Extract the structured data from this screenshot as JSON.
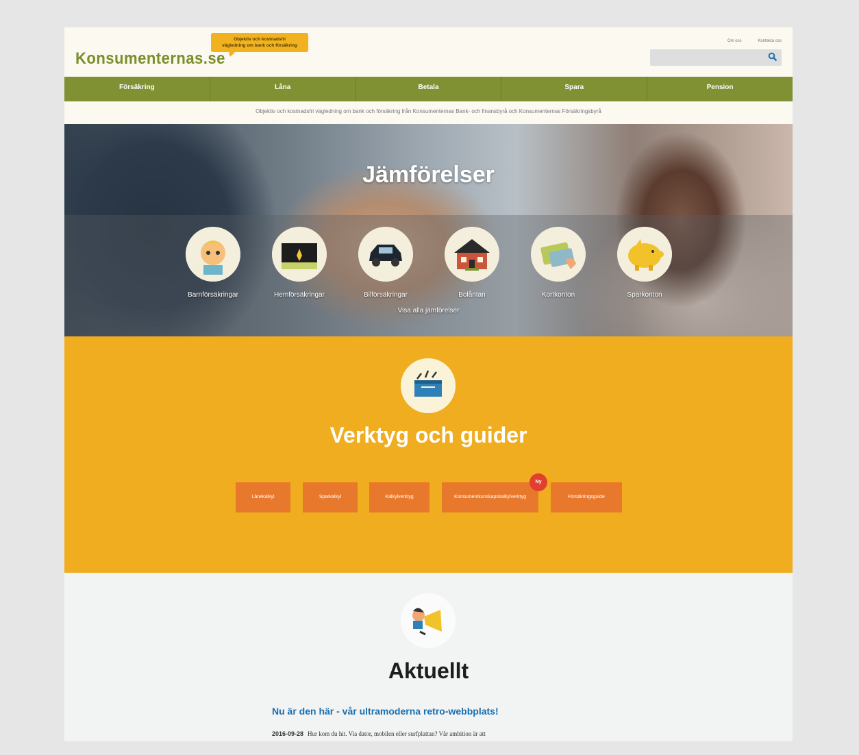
{
  "header": {
    "logo": "Konsumenternas.se",
    "bubble_line1": "Objektiv och kostnadsfri",
    "bubble_line2": "vägledning om bank och försäkring",
    "links": [
      "Om oss",
      "Kontakta oss"
    ],
    "search_placeholder": ""
  },
  "nav": [
    "Försäkring",
    "Låna",
    "Betala",
    "Spara",
    "Pension"
  ],
  "tagline": "Objektiv och kostnadsfri vägledning om bank och försäkring från Konsumenternas Bank- och finansbyrå och Konsumenternas Försäkringsbyrå",
  "hero": {
    "title": "Jämförelser",
    "items": [
      {
        "label": "Barnförsäkringar",
        "icon": "child-icon"
      },
      {
        "label": "Hemförsäkringar",
        "icon": "home-insurance-icon"
      },
      {
        "label": "Bilförsäkringar",
        "icon": "car-icon"
      },
      {
        "label": "Bolåntan",
        "icon": "house-icon"
      },
      {
        "label": "Kortkonton",
        "icon": "card-icon"
      },
      {
        "label": "Sparkonton",
        "icon": "piggy-bank-icon"
      }
    ],
    "more_link": "Visa alla jämförelser"
  },
  "tools": {
    "title": "Verktyg och guider",
    "buttons": [
      "Lånekalkyl",
      "Sparkalkyl",
      "Kalkylverktyg",
      "Konsumentkunskapskalkylverktyg",
      "Försäkringsguide"
    ],
    "badge": "Ny"
  },
  "news": {
    "title": "Aktuellt",
    "article_title": "Nu är den här - vår ultramoderna retro-webbplats!",
    "article_date": "2016-09-28",
    "article_text": "Hur kom du hit. Via dator, mobilen eller surfplattan? Vår ambition är att"
  },
  "colors": {
    "green": "#7f9133",
    "yellow": "#efad1f",
    "orange": "#e8782c",
    "blue_link": "#1a6fb0"
  }
}
